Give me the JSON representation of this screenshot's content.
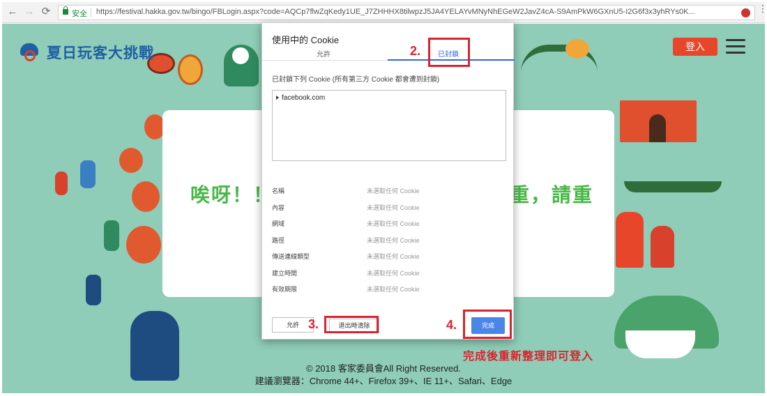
{
  "browser": {
    "back_icon": "←",
    "forward_icon": "→",
    "reload_icon": "⟳",
    "secure_label": "安全",
    "url": "https://festival.hakka.gov.tw/bingo/FBLogin.aspx?code=AQCp7flwZqKedy1UE_J7ZHHHX8tilwpzJ5JA4YELAYvMNyNhEGeW2JavZ4cA-S9AmPkW6GXnU5-I2G6f3x3yhRYs0K...",
    "menu_icon": "⋮"
  },
  "site": {
    "logo_text": "夏日玩客大挑戰",
    "login_label": "登入",
    "oops_left": "唉呀！！",
    "oops_right": "重，請重",
    "footer_line1": "© 2018 客家委員會All Right Reserved.",
    "footer_line2": "建議瀏覽器：Chrome 44+、Firefox 39+、IE 11+、Safari、Edge"
  },
  "dialog": {
    "title": "使用中的 Cookie",
    "tab_allowed": "允許",
    "tab_blocked": "已封鎖",
    "blocked_desc": "已封鎖下列 Cookie (所有第三方 Cookie 都會遭到封鎖)",
    "cookie_site": "facebook.com",
    "properties": [
      {
        "label": "名稱",
        "value": "未選取任何 Cookie"
      },
      {
        "label": "內容",
        "value": "未選取任何 Cookie"
      },
      {
        "label": "網域",
        "value": "未選取任何 Cookie"
      },
      {
        "label": "路徑",
        "value": "未選取任何 Cookie"
      },
      {
        "label": "傳送連線類型",
        "value": "未選取任何 Cookie"
      },
      {
        "label": "建立時間",
        "value": "未選取任何 Cookie"
      },
      {
        "label": "有效期限",
        "value": "未選取任何 Cookie"
      }
    ],
    "allow_button": "允許",
    "clear_button": "退出時清除",
    "done_button": "完成"
  },
  "annotations": {
    "step2": "2.",
    "step3": "3.",
    "step4": "4.",
    "final_note": "完成後重新整理即可登入"
  },
  "colors": {
    "page_bg": "#8fcdb8",
    "accent_red": "#d9232e",
    "login_button": "#e8462b",
    "primary_blue": "#4a86e8",
    "heading_green": "#47b847"
  }
}
